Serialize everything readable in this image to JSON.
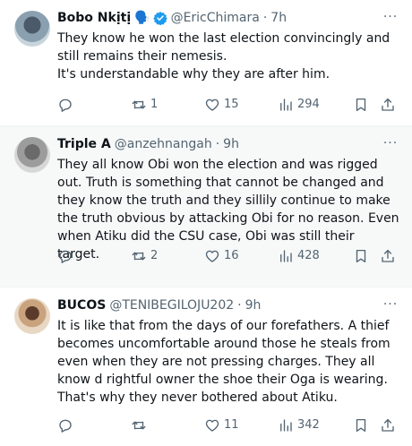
{
  "tweets": [
    {
      "display_name": "Bobo Nkịtị",
      "emoji": "🗣️",
      "verified": true,
      "handle": "@EricChimara",
      "time": "7h",
      "paragraphs": [
        "They know he won the last election convincingly and still remains their nemesis.",
        "It's understandable why they are after him."
      ],
      "replies": "",
      "retweets": "1",
      "likes": "15",
      "views": "294"
    },
    {
      "display_name": "Triple A",
      "emoji": "",
      "verified": false,
      "handle": "@anzehnangah",
      "time": "9h",
      "paragraphs": [
        "They all know Obi won the election and was rigged out. Truth is something that cannot be changed and they know the truth and they sillily continue to make the truth obvious by attacking Obi for no reason. Even when Atiku did the  CSU case, Obi was still their target."
      ],
      "replies": "",
      "retweets": "2",
      "likes": "16",
      "views": "428"
    },
    {
      "display_name": "BUCOS",
      "emoji": "",
      "verified": false,
      "handle": "@TENIBEGILOJU202",
      "time": "9h",
      "paragraphs": [
        "It is like that from the days of our forefathers. A thief becomes uncomfortable around those he steals from even when they are not pressing charges. They all know d rightful owner the shoe their Oga is wearing. That's why they never bothered about Atiku."
      ],
      "replies": "",
      "retweets": "",
      "likes": "11",
      "views": "342"
    }
  ],
  "separator": "·",
  "more_glyph": "···",
  "colors": {
    "verified": "#1d9bf0",
    "secondary_text": "#536471",
    "highlight_bg": "#f7f9f9"
  },
  "icons": [
    "reply-icon",
    "retweet-icon",
    "like-icon",
    "views-icon",
    "bookmark-icon",
    "share-icon",
    "more-icon",
    "verified-badge-icon"
  ]
}
